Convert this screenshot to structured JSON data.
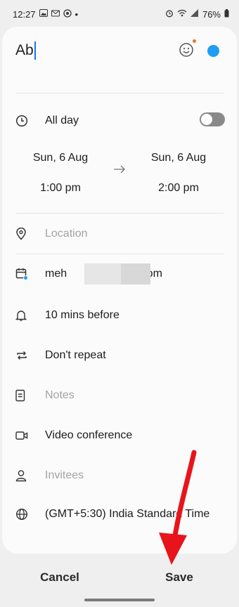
{
  "status_bar": {
    "time": "12:27",
    "dot": "•",
    "battery": "76%"
  },
  "title": {
    "value": "Ab"
  },
  "all_day": {
    "label": "All day",
    "enabled": false
  },
  "start": {
    "date": "Sun, 6 Aug",
    "time": "1:00 pm"
  },
  "end": {
    "date": "Sun, 6 Aug",
    "time": "2:00 pm"
  },
  "location": {
    "placeholder": "Location"
  },
  "calendar_account": {
    "prefix": "meh",
    "suffix": "il.com"
  },
  "reminder": {
    "value": "10 mins before"
  },
  "repeat": {
    "value": "Don't repeat"
  },
  "notes": {
    "placeholder": "Notes"
  },
  "video": {
    "label": "Video conference"
  },
  "invitees": {
    "placeholder": "Invitees"
  },
  "timezone": {
    "value": "(GMT+5:30) India Standard Time"
  },
  "actions": {
    "cancel": "Cancel",
    "save": "Save"
  },
  "colors": {
    "accent": "#1f9df0",
    "annotation_arrow": "#e8141b"
  }
}
